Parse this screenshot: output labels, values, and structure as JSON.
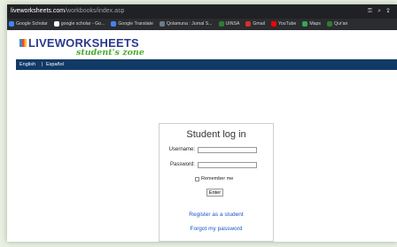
{
  "browser": {
    "url_host": "liveworksheets.com",
    "url_path": "/workbooks/index.asp",
    "toolbar_icons": [
      "key-icon",
      "zoom-icon",
      "share-icon"
    ]
  },
  "bookmarks": [
    {
      "label": "Google Scholar",
      "color": "#4285f4"
    },
    {
      "label": "google scholar - Go...",
      "color": "#ffffff"
    },
    {
      "label": "Google Translate",
      "color": "#4285f4"
    },
    {
      "label": "Qolamuna : Jurnal S...",
      "color": "#6e7a8c"
    },
    {
      "label": "UINSA",
      "color": "#2e7d32"
    },
    {
      "label": "Gmail",
      "color": "#d93025"
    },
    {
      "label": "YouTube",
      "color": "#ff0000"
    },
    {
      "label": "Maps",
      "color": "#34a853"
    },
    {
      "label": "Qur'an",
      "color": "#2e7d32"
    }
  ],
  "brand": {
    "name": "LIVEWORKSHEETS",
    "tagline": "student's zone"
  },
  "nav": {
    "english": "English",
    "separator": "|",
    "spanish": "Español"
  },
  "login": {
    "title": "Student log in",
    "username_label": "Username:",
    "username_value": "",
    "password_label": "Password:",
    "password_value": "",
    "remember_label": "Remember me",
    "remember_checked": false,
    "enter_label": "Enter",
    "register_link": "Register as a student",
    "forgot_link": "Forgot my password"
  }
}
